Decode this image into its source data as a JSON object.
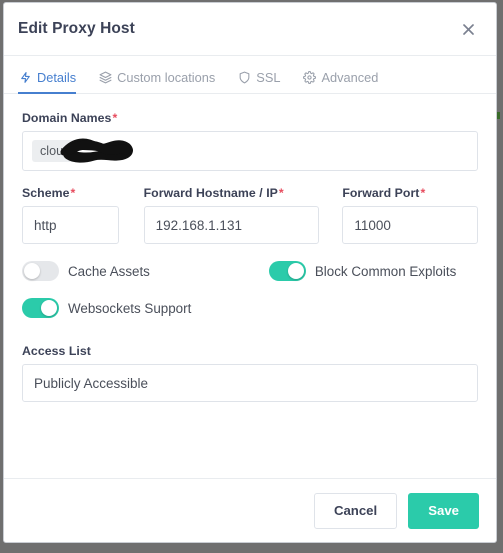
{
  "window": {
    "title": "Edit Proxy Host",
    "close_icon": "close-icon",
    "chrome_color": "#6f6f6f"
  },
  "tabs": [
    {
      "label": "Details",
      "icon": "bolt-icon",
      "active": true
    },
    {
      "label": "Custom locations",
      "icon": "layers-icon",
      "active": false
    },
    {
      "label": "SSL",
      "icon": "shield-icon",
      "active": false
    },
    {
      "label": "Advanced",
      "icon": "gear-icon",
      "active": false
    }
  ],
  "form": {
    "domain_names": {
      "label": "Domain Names",
      "required_marker": "*",
      "tag_value": "cloud",
      "redacted": true,
      "placeholder": ""
    },
    "scheme": {
      "label": "Scheme",
      "required_marker": "*",
      "value": "http",
      "placeholder": "http"
    },
    "forward_hostname": {
      "label": "Forward Hostname / IP",
      "required_marker": "*",
      "value": "192.168.1.131",
      "placeholder": ""
    },
    "forward_port": {
      "label": "Forward Port",
      "required_marker": "*",
      "value": "11000",
      "placeholder": ""
    },
    "cache_assets": {
      "label": "Cache Assets",
      "on": false
    },
    "block_common_exploits": {
      "label": "Block Common Exploits",
      "on": true
    },
    "websockets_support": {
      "label": "Websockets Support",
      "on": true
    },
    "access_list": {
      "label": "Access List",
      "value": "Publicly Accessible",
      "placeholder": ""
    }
  },
  "footer": {
    "cancel_label": "Cancel",
    "save_label": "Save"
  },
  "colors": {
    "accent_teal": "#2bcbaa",
    "active_tab_blue": "#467fcf",
    "required_red": "#e74c5e",
    "text_dark": "#3c4257",
    "text_muted": "#9aa0ab",
    "border": "#dfe3e9"
  }
}
